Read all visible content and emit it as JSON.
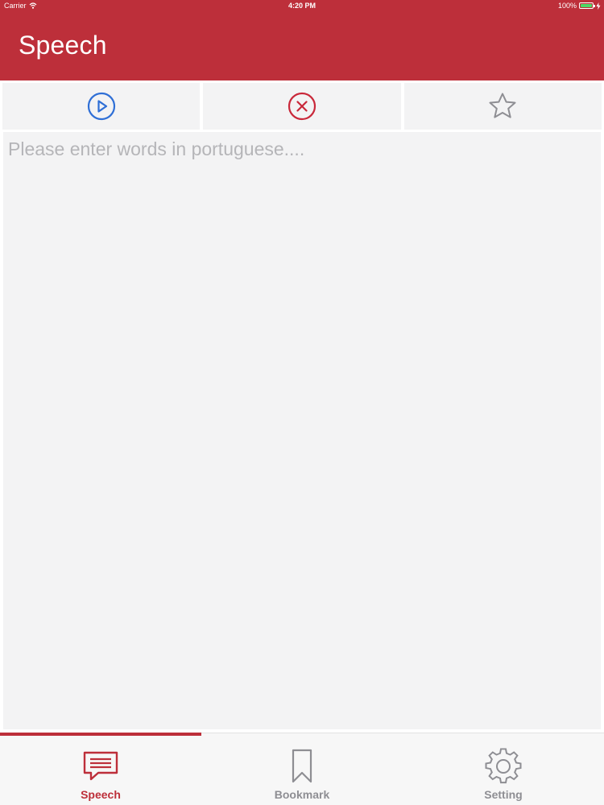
{
  "status_bar": {
    "carrier": "Carrier",
    "time": "4:20 PM",
    "battery": "100%"
  },
  "header": {
    "title": "Speech"
  },
  "toolbar": {
    "play_icon": "play-circle-icon",
    "clear_icon": "close-circle-icon",
    "bookmark_icon": "star-icon"
  },
  "editor": {
    "value": "",
    "placeholder": "Please enter words in portuguese...."
  },
  "tabs": [
    {
      "label": "Speech",
      "icon": "speech-bubble-icon",
      "active": true
    },
    {
      "label": "Bookmark",
      "icon": "bookmark-icon",
      "active": false
    },
    {
      "label": "Setting",
      "icon": "gear-icon",
      "active": false
    }
  ],
  "colors": {
    "brand": "#bd2f3a",
    "play_blue": "#2f6fd6",
    "clear_red": "#c9283a",
    "inactive_gray": "#8e8e93",
    "surface": "#f3f3f4"
  }
}
